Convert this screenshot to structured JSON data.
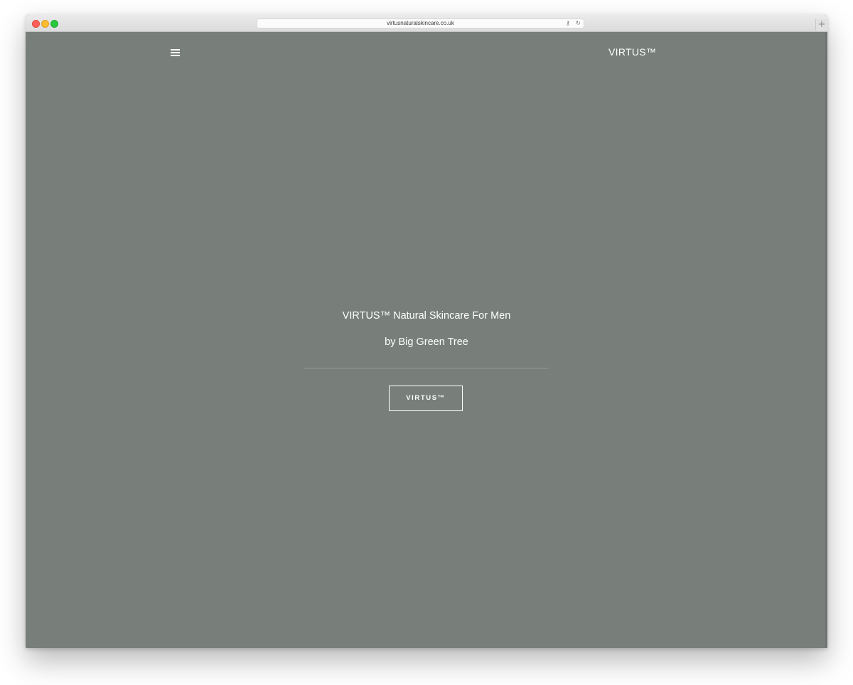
{
  "browser": {
    "url": "virtusnaturalskincare.co.uk",
    "key_icon": "key-icon",
    "reload_icon": "reload-icon",
    "new_tab_symbol": "+"
  },
  "header": {
    "menu_icon": "hamburger-menu-icon",
    "brand": "VIRTUS™"
  },
  "hero": {
    "title": "VIRTUS™ Natural Skincare For Men",
    "subtitle": "by Big Green Tree",
    "button_label": "VIRTUS™"
  },
  "colors": {
    "background": "#787f7b",
    "text": "#ffffff"
  }
}
